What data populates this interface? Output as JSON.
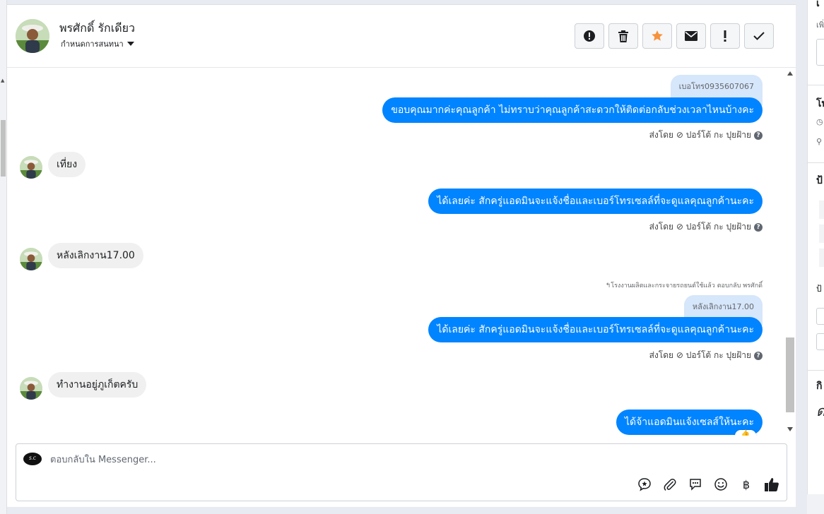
{
  "header": {
    "contact_name": "พรศักดิ์ รักเดียว",
    "assign_label": "กำหนดการสนทนา"
  },
  "toolbar": {
    "buttons": [
      "report-icon",
      "trash-icon",
      "star-icon",
      "envelope-icon",
      "exclamation-icon",
      "check-icon"
    ],
    "star_color": "#f7923b"
  },
  "messages": {
    "m1_quote": "เบอโทร0935607067",
    "m1_text": "ขอบคุณมากค่ะคุณลูกค้า ไม่ทราบว่าคุณลูกค้าสะดวกให้ติดต่อกลับช่วงเวลาไหนบ้างคะ",
    "m1_sentby": "ส่งโดย ⊘ ปอร์โต้ กะ ปุยฝ้าย",
    "m2_text": "เที่ยง",
    "m3_text": "ได้เลยค่ะ สักครู่แอดมินจะแจ้งชื่อและเบอร์โทรเซลล์ที่จะดูแลคุณลูกค้านะคะ",
    "m3_sentby": "ส่งโดย ⊘ ปอร์โต้ กะ ปุยฝ้าย",
    "m4_text": "หลังเลิกงาน17.00",
    "m5_reply_note": "↰โรงงานผลิตและกระจายรถยนต์ใช้แล้ว ตอบกลับ พรศักดิ์",
    "m5_quote": "หลังเลิกงาน17.00",
    "m5_text": "ได้เลยค่ะ สักครู่แอดมินจะแจ้งชื่อและเบอร์โทรเซลล์ที่จะดูแลคุณลูกค้านะคะ",
    "m5_sentby": "ส่งโดย ⊘ ปอร์โต้ กะ ปุยฝ้าย",
    "m6_text": "ทำงานอยู่ภูเก็ตครับ",
    "m7_text": "ได้จ้าแอดมินแจ้งเซลส์ให้นะคะ"
  },
  "composer": {
    "placeholder": "ตอบกลับใน Messenger...",
    "currency_symbol": "฿"
  },
  "accent": "#0084ff",
  "right_panel": {
    "t1": "เ",
    "t2": "เพิ่",
    "t3": "โท",
    "t4": "ป้",
    "t5": "ป้",
    "t6": "กิ",
    "t7": "ด"
  }
}
